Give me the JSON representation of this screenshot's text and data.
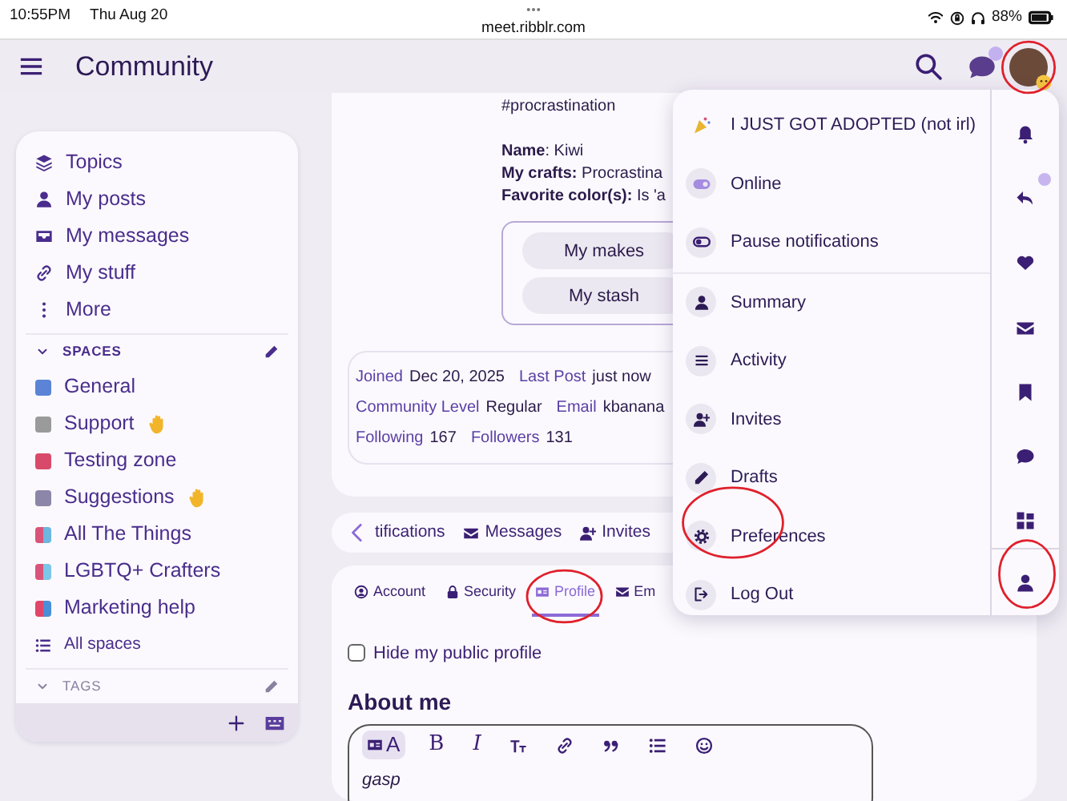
{
  "status_bar": {
    "time": "10:55PM",
    "date": "Thu Aug 20",
    "battery": "88%"
  },
  "browser": {
    "url": "meet.ribblr.com"
  },
  "header": {
    "title": "Community",
    "chat_unread": true,
    "avatar_circled": true
  },
  "sidebar": {
    "items": [
      {
        "label": "Topics"
      },
      {
        "label": "My posts"
      },
      {
        "label": "My messages"
      },
      {
        "label": "My stuff"
      },
      {
        "label": "More"
      }
    ],
    "spaces": {
      "title": "SPACES",
      "items": [
        {
          "label": "General",
          "color": "#5b84d6",
          "has_emoji": false
        },
        {
          "label": "Support",
          "color": "#9a9a9a",
          "has_emoji": true
        },
        {
          "label": "Testing zone",
          "color": "#d94a6a",
          "has_emoji": false
        },
        {
          "label": "Suggestions",
          "color": "#8c86a8",
          "has_emoji": true
        },
        {
          "label": "All The Things",
          "color": "#d9547a",
          "accent": {
            "color": "#6cb6e0"
          },
          "has_emoji": false
        },
        {
          "label": "LGBTQ+ Crafters",
          "color": "#d9547a",
          "accent": {
            "color": "#7cc6e8"
          },
          "has_emoji": false
        },
        {
          "label": "Marketing help",
          "color": "#e0466a",
          "accent": {
            "color": "#4a8ed8"
          },
          "has_emoji": false
        }
      ],
      "all_label": "All spaces"
    },
    "tags": {
      "title": "TAGS"
    }
  },
  "profile": {
    "hashtag": "#procrastination",
    "fields": [
      "**Name**: Kiwi",
      "**My crafts:** Procrastina",
      "**Favorite color(s):** Is 'a"
    ],
    "buttons": [
      "My makes",
      "My stash"
    ],
    "stats": [
      [
        {
          "label": "Joined",
          "value": "Dec 20, 2025"
        },
        {
          "label": "Last Post",
          "value": "just now"
        }
      ],
      [
        {
          "label": "Community Level",
          "value": "Regular"
        },
        {
          "label": "Email",
          "value": "kbanana"
        }
      ],
      [
        {
          "label": "Following",
          "value": "167"
        },
        {
          "label": "Followers",
          "value": "131"
        }
      ]
    ]
  },
  "tab_bar": [
    {
      "label": "tifications"
    },
    {
      "label": "Messages"
    },
    {
      "label": "Invites"
    }
  ],
  "settings": {
    "tabs": [
      {
        "label": "Account",
        "selected": false,
        "circled": false
      },
      {
        "label": "Security",
        "selected": false,
        "circled": false
      },
      {
        "label": "Profile",
        "selected": true,
        "circled": true
      },
      {
        "label": "Em",
        "selected": false,
        "circled": false
      }
    ],
    "hide_profile": {
      "label": "Hide my public profile",
      "checked": false
    },
    "about_heading": "About me",
    "editor": {
      "toolbar": [
        {
          "kind": "mode",
          "label": "A",
          "selected": true
        },
        {
          "kind": "bold",
          "label": "B"
        },
        {
          "kind": "italic",
          "label": "I"
        },
        {
          "kind": "icon"
        },
        {
          "kind": "icon"
        },
        {
          "kind": "icon"
        },
        {
          "kind": "icon"
        },
        {
          "kind": "icon"
        }
      ],
      "text": "gasp"
    }
  },
  "menu": {
    "top": [
      {
        "kind": "status",
        "label": "I JUST GOT ADOPTED (not irl)"
      },
      {
        "kind": "toggle",
        "label": "Online",
        "on": true
      },
      {
        "kind": "toggle",
        "label": "Pause notifications",
        "on": false
      }
    ],
    "links": [
      {
        "label": "Summary",
        "circled": false
      },
      {
        "label": "Activity",
        "circled": false
      },
      {
        "label": "Invites",
        "circled": false
      },
      {
        "label": "Drafts",
        "circled": false
      },
      {
        "label": "Preferences",
        "circled": true
      },
      {
        "label": "Log Out",
        "circled": false
      }
    ],
    "rail": [
      {
        "badge": false,
        "circled": false
      },
      {
        "badge": true,
        "circled": false
      },
      {
        "badge": false,
        "circled": false
      },
      {
        "badge": false,
        "circled": false
      },
      {
        "badge": false,
        "circled": false
      },
      {
        "badge": false,
        "circled": false
      },
      {
        "badge": false,
        "circled": false
      },
      {
        "badge": false,
        "circled": true
      }
    ]
  }
}
